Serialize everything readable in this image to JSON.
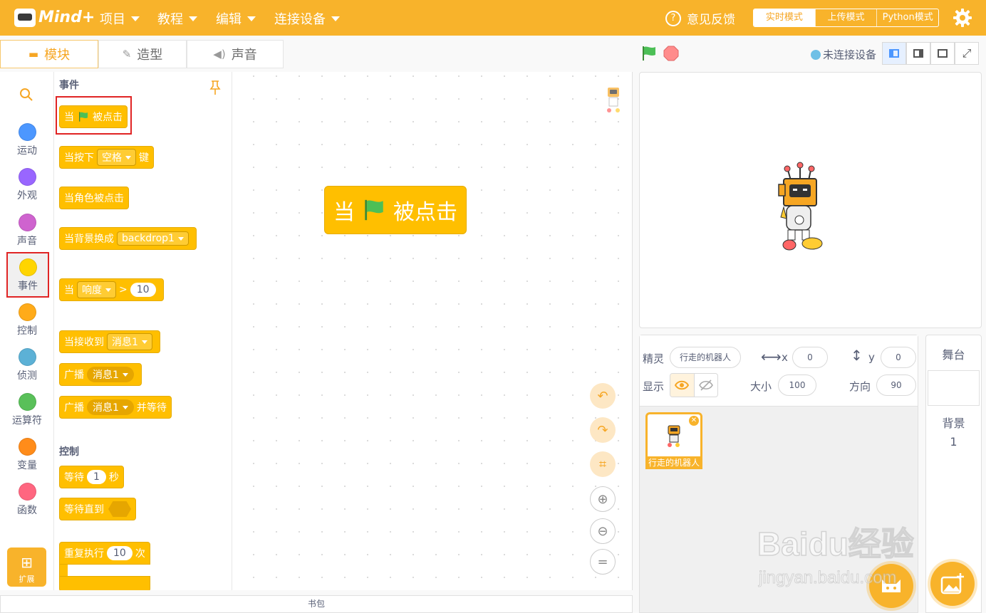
{
  "app": {
    "logo_text": "Mind+"
  },
  "menu": [
    {
      "label": "项目"
    },
    {
      "label": "教程"
    },
    {
      "label": "编辑"
    },
    {
      "label": "连接设备"
    }
  ],
  "feedback": {
    "label": "意见反馈"
  },
  "modes": [
    "实时模式",
    "上传模式",
    "Python模式"
  ],
  "tabs": [
    "模块",
    "造型",
    "声音"
  ],
  "connection": {
    "status": "未连接设备"
  },
  "categories": [
    {
      "label": "运动",
      "color": "#4c97ff"
    },
    {
      "label": "外观",
      "color": "#9966ff"
    },
    {
      "label": "声音",
      "color": "#cf63cf"
    },
    {
      "label": "事件",
      "color": "#ffd500"
    },
    {
      "label": "控制",
      "color": "#ffab19"
    },
    {
      "label": "侦测",
      "color": "#5cb1d6"
    },
    {
      "label": "运算符",
      "color": "#59c059"
    },
    {
      "label": "变量",
      "color": "#ff8c1a"
    },
    {
      "label": "函数",
      "color": "#ff6680"
    }
  ],
  "extension": {
    "label": "扩展"
  },
  "palette": {
    "events_title": "事件",
    "control_title": "控制",
    "when_flag": {
      "pre": "当",
      "post": "被点击"
    },
    "when_key": {
      "pre": "当按下",
      "dd": "空格",
      "post": "键"
    },
    "when_sprite_clicked": "当角色被点击",
    "when_backdrop": {
      "pre": "当背景换成",
      "dd": "backdrop1"
    },
    "when_gt": {
      "pre": "当",
      "dd": "响度",
      "op": ">",
      "val": "10"
    },
    "when_receive": {
      "pre": "当接收到",
      "dd": "消息1"
    },
    "broadcast": {
      "pre": "广播",
      "dd": "消息1"
    },
    "broadcast_wait": {
      "pre": "广播",
      "dd": "消息1",
      "post": "并等待"
    },
    "wait": {
      "pre": "等待",
      "val": "1",
      "post": "秒"
    },
    "wait_until": {
      "pre": "等待直到"
    },
    "repeat": {
      "pre": "重复执行",
      "val": "10",
      "post": "次"
    }
  },
  "workspace": {
    "hat": {
      "pre": "当",
      "post": "被点击"
    }
  },
  "backpack": {
    "label": "书包"
  },
  "sprite": {
    "sprite_label": "精灵",
    "name": "行走的机器人",
    "x_label": "x",
    "x": "0",
    "y_label": "y",
    "y": "0",
    "show_label": "显示",
    "size_label": "大小",
    "size": "100",
    "direction_label": "方向",
    "direction": "90",
    "thumb_name": "行走的机器人"
  },
  "stage_panel": {
    "title": "舞台",
    "backdrop_label": "背景",
    "backdrop_count": "1"
  },
  "watermark": {
    "big": "Baidu经验",
    "small": "jingyan.baidu.com"
  },
  "colors": {
    "accent": "#f8b32b",
    "event_block": "#ffbf00",
    "highlight": "#e02424"
  }
}
